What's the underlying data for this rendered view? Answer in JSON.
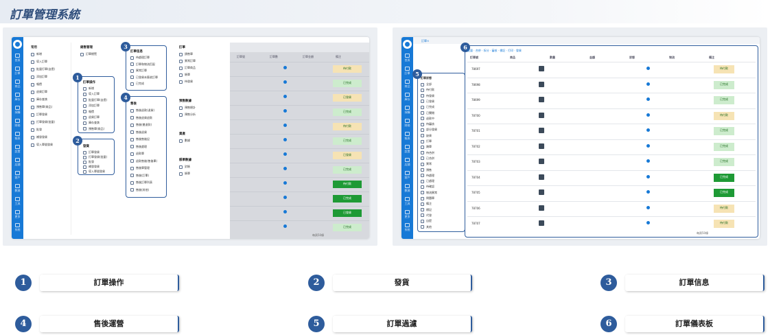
{
  "banner": {
    "title": "訂單管理系統"
  },
  "left_screenshot": {
    "groups": [
      {
        "title": "訂單操作",
        "items": [
          "新增",
          "導入訂單",
          "批量打單(自提)",
          "添加訂單",
          "報價",
          "退貨訂單",
          "庫存查詢",
          "預售單(商品)"
        ]
      },
      {
        "title": "發貨",
        "items": [
          "訂單發貨",
          "打單發貨(批量)",
          "批發",
          "補發發貨",
          "導入單號發貨"
        ]
      },
      {
        "title": "訂單信息",
        "items": [
          "待處理訂單",
          "訂單和物流匹配",
          "異常訂單",
          "已發貨未簽收訂單",
          "已完成"
        ]
      },
      {
        "title": "售後",
        "items": [
          "售後退款(退貨)",
          "售後退貨退款",
          "售後(搶退款)",
          "售後退貨",
          "售後售後記",
          "售後處理",
          "退款單",
          "退款售後(售後單)",
          "售後單管理",
          "售後(訂單)",
          "售後訂單列表",
          "售後(其他)"
        ]
      }
    ],
    "right_groups": [
      {
        "title": "訂單",
        "items": [
          "銷售單",
          "異常訂單",
          "訂單商品",
          "賬單",
          "待發貨"
        ]
      },
      {
        "title": "預售數據",
        "items": [
          "預售總計",
          "預售分析"
        ]
      },
      {
        "title": "資產",
        "items": [
          "數據"
        ]
      },
      {
        "title": "賬單數據",
        "items": [
          "對賬",
          "賬單"
        ]
      }
    ],
    "nav": [
      "首頁",
      "訂單",
      "商品",
      "庫存",
      "採購",
      "財務",
      "報表",
      "設置",
      "店鋪",
      "客戶",
      "數據",
      "工具",
      "更多",
      "系統"
    ],
    "table_header": [
      "訂單號",
      "訂單數",
      "訂單金額",
      "備注"
    ],
    "status_labels": [
      "待付款",
      "已完成",
      "已發貨",
      "已完成"
    ],
    "pager": "每頁50條"
  },
  "right_screenshot": {
    "filter_title": "訂單狀態",
    "filters": [
      "全部",
      "待付款",
      "待發貨",
      "已發貨",
      "已完成",
      "已關閉",
      "退款中",
      "待審核",
      "部分發貨",
      "缺貨",
      "打單",
      "鎖單",
      "待合併",
      "已合併",
      "異常",
      "預售",
      "待處理",
      "已處理",
      "待確認",
      "物流異常",
      "問題單",
      "備注",
      "標記",
      "代發",
      "自提",
      "其他"
    ],
    "table_columns": [
      "訂單號",
      "商品",
      "數量",
      "金額",
      "狀態",
      "物流",
      "備注"
    ],
    "rows": [
      {
        "id": "78697",
        "status": "待付款"
      },
      {
        "id": "78698",
        "status": "已完成"
      },
      {
        "id": "78699",
        "status": "已完成"
      },
      {
        "id": "78700",
        "status": "待付款"
      },
      {
        "id": "78701",
        "status": "已完成"
      },
      {
        "id": "78702",
        "status": "已完成"
      },
      {
        "id": "78703",
        "status": "已完成"
      },
      {
        "id": "78704",
        "status": "已完成"
      },
      {
        "id": "78705",
        "status": "已完成"
      },
      {
        "id": "78706",
        "status": "待付款"
      },
      {
        "id": "78707",
        "status": "待付款"
      }
    ],
    "pager": "每頁50條"
  },
  "legend": [
    {
      "num": "1",
      "label": "訂單操作"
    },
    {
      "num": "2",
      "label": "發貨"
    },
    {
      "num": "3",
      "label": "訂單信息"
    },
    {
      "num": "4",
      "label": "售後運營"
    },
    {
      "num": "5",
      "label": "訂單過濾"
    },
    {
      "num": "6",
      "label": "訂單儀表板"
    }
  ],
  "colors": {
    "brand": "#1779d6",
    "accent": "#2e5c9c",
    "paid": "#f6e3b4",
    "done": "#1e9a35",
    "done_light": "#cdeccd"
  }
}
